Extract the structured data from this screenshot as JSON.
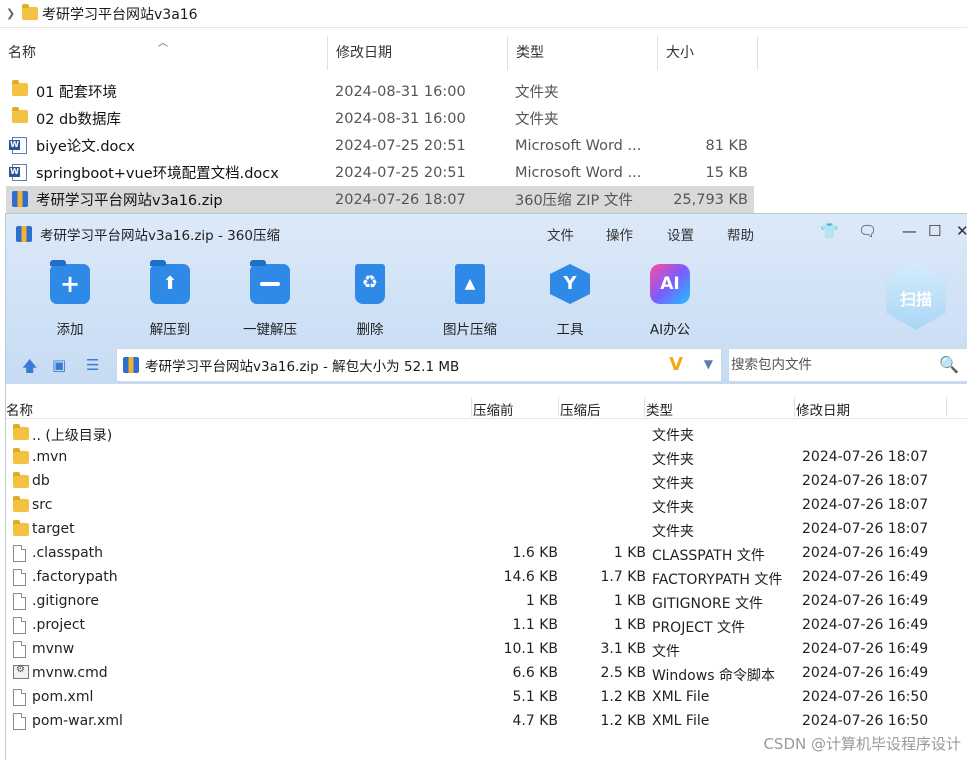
{
  "explorer": {
    "path": "考研学习平台网站v3a16",
    "columns": {
      "name": "名称",
      "modified": "修改日期",
      "type": "类型",
      "size": "大小"
    },
    "rows": [
      {
        "name": "01 配套环境",
        "date": "2024-08-31 16:00",
        "type": "文件夹",
        "size": "",
        "icon": "folder-icon"
      },
      {
        "name": "02 db数据库",
        "date": "2024-08-31 16:00",
        "type": "文件夹",
        "size": "",
        "icon": "folder-icon"
      },
      {
        "name": "biye论文.docx",
        "date": "2024-07-25 20:51",
        "type": "Microsoft Word ...",
        "size": "81 KB",
        "icon": "word-document-icon"
      },
      {
        "name": "springboot+vue环境配置文档.docx",
        "date": "2024-07-25 20:51",
        "type": "Microsoft Word ...",
        "size": "15 KB",
        "icon": "word-document-icon"
      },
      {
        "name": "考研学习平台网站v3a16.zip",
        "date": "2024-07-26 18:07",
        "type": "360压缩 ZIP 文件",
        "size": "25,793 KB",
        "icon": "zip-archive-icon",
        "selected": true
      }
    ]
  },
  "zip_window": {
    "title": "考研学习平台网站v3a16.zip - 360压缩",
    "menu": [
      "文件",
      "操作",
      "设置",
      "帮助"
    ],
    "toolbar": {
      "add": "添加",
      "extract_to": "解压到",
      "one_click_extract": "一键解压",
      "delete": "删除",
      "image_compress": "图片压缩",
      "tools": "工具",
      "ai_office": "AI办公",
      "scan": "扫描"
    },
    "address": "考研学习平台网站v3a16.zip - 解包大小为 52.1 MB",
    "search_placeholder": "搜索包内文件",
    "columns": {
      "name": "名称",
      "before": "压缩前",
      "after": "压缩后",
      "type": "类型",
      "modified": "修改日期"
    },
    "files": [
      {
        "name": ".. (上级目录)",
        "before": "",
        "after": "",
        "type": "文件夹",
        "date": "",
        "icon": "folder"
      },
      {
        "name": ".mvn",
        "before": "",
        "after": "",
        "type": "文件夹",
        "date": "2024-07-26 18:07",
        "icon": "folder"
      },
      {
        "name": "db",
        "before": "",
        "after": "",
        "type": "文件夹",
        "date": "2024-07-26 18:07",
        "icon": "folder"
      },
      {
        "name": "src",
        "before": "",
        "after": "",
        "type": "文件夹",
        "date": "2024-07-26 18:07",
        "icon": "folder"
      },
      {
        "name": "target",
        "before": "",
        "after": "",
        "type": "文件夹",
        "date": "2024-07-26 18:07",
        "icon": "folder"
      },
      {
        "name": ".classpath",
        "before": "1.6 KB",
        "after": "1 KB",
        "type": "CLASSPATH 文件",
        "date": "2024-07-26 16:49",
        "icon": "file"
      },
      {
        "name": ".factorypath",
        "before": "14.6 KB",
        "after": "1.7 KB",
        "type": "FACTORYPATH 文件",
        "date": "2024-07-26 16:49",
        "icon": "file"
      },
      {
        "name": ".gitignore",
        "before": "1 KB",
        "after": "1 KB",
        "type": "GITIGNORE 文件",
        "date": "2024-07-26 16:49",
        "icon": "file"
      },
      {
        "name": ".project",
        "before": "1.1 KB",
        "after": "1 KB",
        "type": "PROJECT 文件",
        "date": "2024-07-26 16:49",
        "icon": "file"
      },
      {
        "name": "mvnw",
        "before": "10.1 KB",
        "after": "3.1 KB",
        "type": "文件",
        "date": "2024-07-26 16:49",
        "icon": "file"
      },
      {
        "name": "mvnw.cmd",
        "before": "6.6 KB",
        "after": "2.5 KB",
        "type": "Windows 命令脚本",
        "date": "2024-07-26 16:49",
        "icon": "cmd"
      },
      {
        "name": "pom.xml",
        "before": "5.1 KB",
        "after": "1.2 KB",
        "type": "XML File",
        "date": "2024-07-26 16:50",
        "icon": "file"
      },
      {
        "name": "pom-war.xml",
        "before": "4.7 KB",
        "after": "1.2 KB",
        "type": "XML File",
        "date": "2024-07-26 16:50",
        "icon": "file"
      }
    ]
  },
  "watermark": "CSDN @计算机毕设程序设计"
}
